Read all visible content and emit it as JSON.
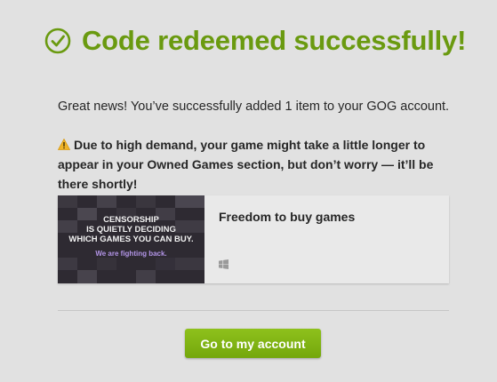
{
  "header": {
    "title": "Code redeemed successfully!",
    "icon": "check-circle-icon",
    "color": "#6a9a10"
  },
  "message": {
    "info": "Great news! You’ve successfully added 1 item to your GOG account.",
    "warning_icon": "warning-icon",
    "warning": "Due to high demand, your game might take a little longer to appear in your Owned Games section, but don’t worry — it’ll be there shortly!"
  },
  "item": {
    "cover": {
      "line1": "Censorship",
      "line2": "is quietly deciding",
      "line3": "which games you can buy.",
      "tagline": "We are fighting back."
    },
    "title": "Freedom to buy games",
    "platform_icon": "windows-icon"
  },
  "actions": {
    "account_button": "Go to my account",
    "button_color": "#80b516"
  }
}
